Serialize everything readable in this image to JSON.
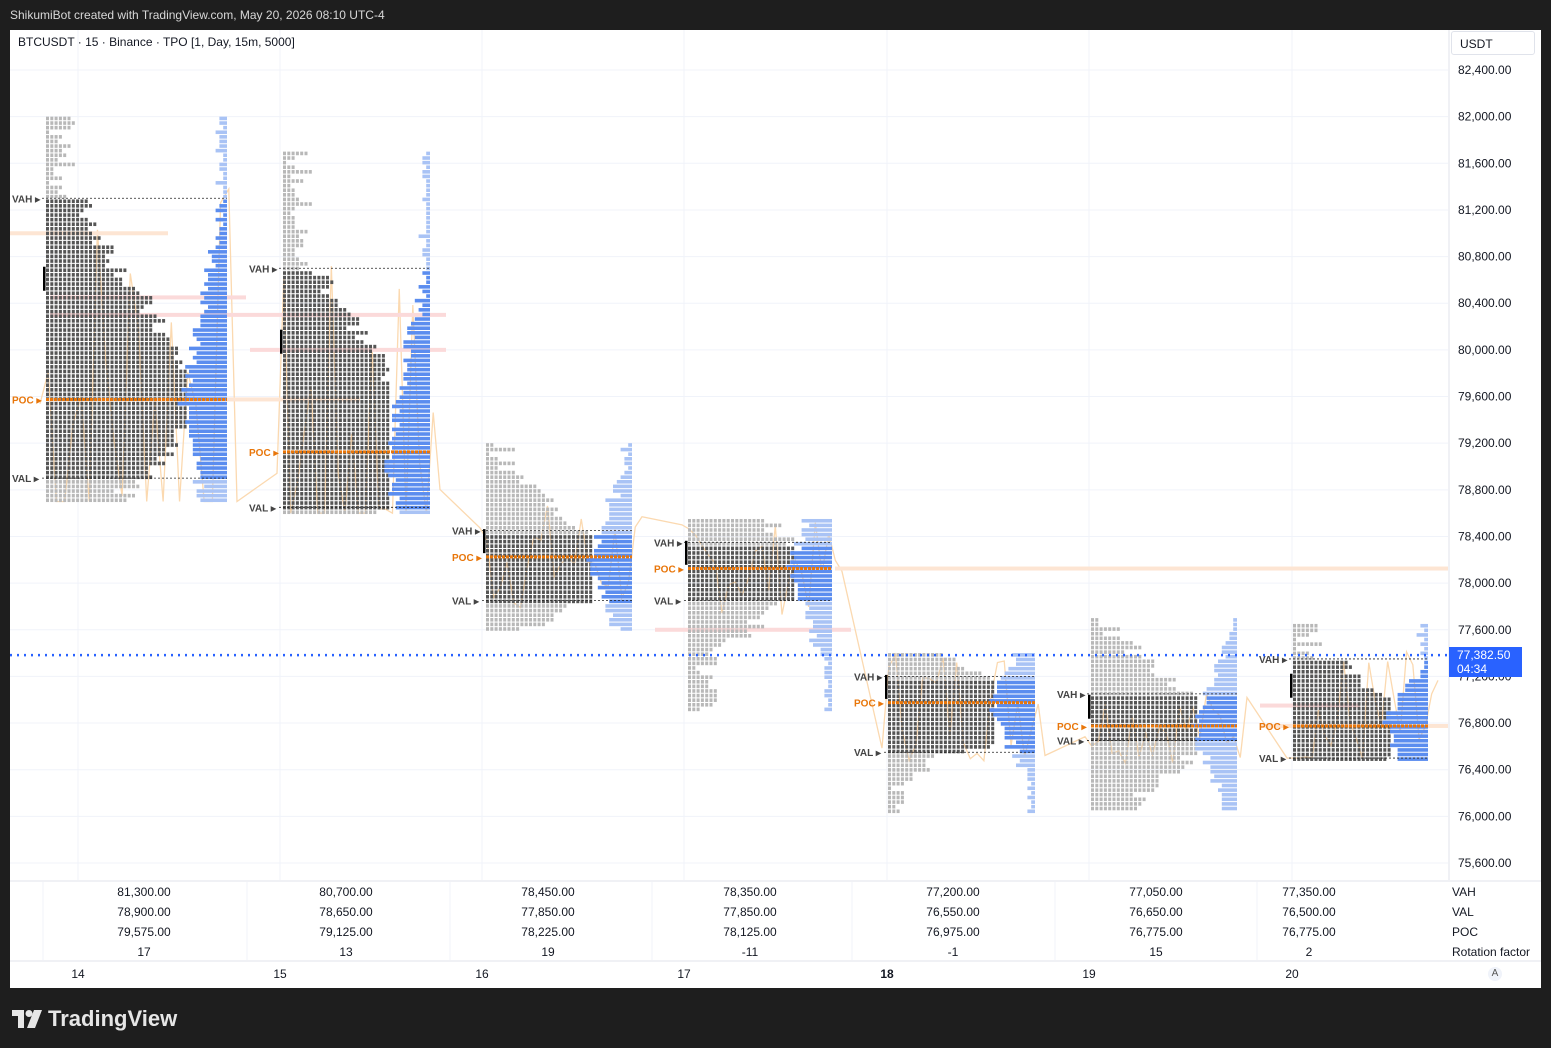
{
  "header": {
    "attribution": "ShikumiBot created with TradingView.com, May 20, 2026 08:10 UTC-4"
  },
  "symbol_line": "BTCUSDT · 15 · Binance · TPO [1, Day, 15m, 5000]",
  "currency_label": "USDT",
  "current_price": {
    "value": "77,382.50",
    "countdown": "04:34"
  },
  "auto_scale_label": "A",
  "footer": {
    "brand": "TradingView"
  },
  "colors": {
    "profile_gray_dark": "#555555",
    "profile_gray_light": "#b8b8b8",
    "profile_blue": "#5b8def",
    "profile_blue_light": "#a9c3f5",
    "poc_orange": "#e8760a",
    "current_price_blue": "#2962ff",
    "price_line": "#fbd9b0",
    "single_print_pink": "#fbdada",
    "naked_poc_peach": "#fde5d3"
  },
  "level_labels": {
    "vah": "VAH",
    "val": "VAL",
    "poc": "POC"
  },
  "table": {
    "row_labels": [
      "VAH",
      "VAL",
      "POC",
      "Rotation factor"
    ],
    "sessions": [
      {
        "vah": "81,300.00",
        "val": "78,900.00",
        "poc": "79,575.00",
        "rf": "17"
      },
      {
        "vah": "80,700.00",
        "val": "78,650.00",
        "poc": "79,125.00",
        "rf": "13"
      },
      {
        "vah": "78,450.00",
        "val": "77,850.00",
        "poc": "78,225.00",
        "rf": "19"
      },
      {
        "vah": "78,350.00",
        "val": "77,850.00",
        "poc": "78,125.00",
        "rf": "-11"
      },
      {
        "vah": "77,200.00",
        "val": "76,550.00",
        "poc": "76,975.00",
        "rf": "-1"
      },
      {
        "vah": "77,050.00",
        "val": "76,650.00",
        "poc": "76,775.00",
        "rf": "15"
      },
      {
        "vah": "77,350.00",
        "val": "76,500.00",
        "poc": "76,775.00",
        "rf": "2"
      }
    ]
  },
  "chart_data": {
    "type": "tpo_profile",
    "y_axis": {
      "range": [
        75400,
        82600
      ],
      "ticks": [
        "82,400.00",
        "82,000.00",
        "81,600.00",
        "81,200.00",
        "80,800.00",
        "80,400.00",
        "80,000.00",
        "79,600.00",
        "79,200.00",
        "78,800.00",
        "78,400.00",
        "78,000.00",
        "77,600.00",
        "77,200.00",
        "76,800.00",
        "76,400.00",
        "76,000.00",
        "75,600.00"
      ],
      "tick_values": [
        82400,
        82000,
        81600,
        81200,
        80800,
        80400,
        80000,
        79600,
        79200,
        78800,
        78400,
        78000,
        77600,
        77200,
        76800,
        76400,
        76000,
        75600
      ]
    },
    "x_axis": {
      "dates": [
        "14",
        "15",
        "16",
        "17",
        "18",
        "19",
        "20"
      ],
      "bold_date": "18"
    },
    "sessions": [
      {
        "date": "14",
        "high": 82000,
        "low": 78700,
        "vah": 81300,
        "val": 78900,
        "poc": 79575
      },
      {
        "date": "15",
        "high": 81700,
        "low": 78600,
        "vah": 80700,
        "val": 78650,
        "poc": 79125
      },
      {
        "date": "16",
        "high": 79200,
        "low": 77600,
        "vah": 78450,
        "val": 77850,
        "poc": 78225
      },
      {
        "date": "17",
        "high": 78550,
        "low": 76900,
        "vah": 78350,
        "val": 77850,
        "poc": 78125
      },
      {
        "date": "18",
        "high": 77400,
        "low": 76050,
        "vah": 77200,
        "val": 76550,
        "poc": 76975
      },
      {
        "date": "19",
        "high": 77700,
        "low": 76050,
        "vah": 77050,
        "val": 76650,
        "poc": 76775
      },
      {
        "date": "20",
        "high": 77650,
        "low": 76500,
        "vah": 77350,
        "val": 76500,
        "poc": 76775
      }
    ],
    "current_price": 77382.5,
    "grid": true
  }
}
